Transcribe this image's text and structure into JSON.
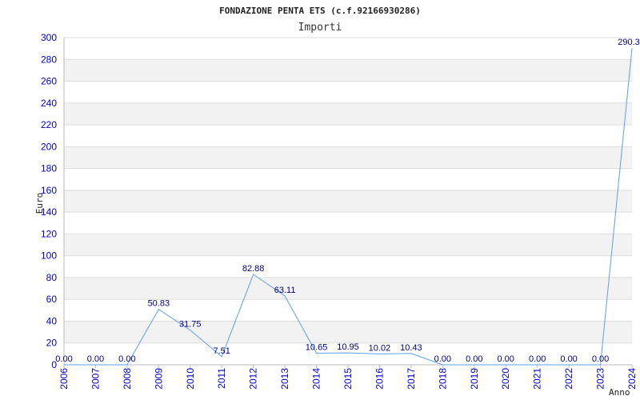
{
  "chart_data": {
    "type": "line",
    "title": "FONDAZIONE PENTA ETS (c.f.92166930286)",
    "subtitle": "Importi",
    "xlabel": "Anno",
    "ylabel": "Euro",
    "categories": [
      "2006",
      "2007",
      "2008",
      "2009",
      "2010",
      "2011",
      "2012",
      "2013",
      "2014",
      "2015",
      "2016",
      "2017",
      "2018",
      "2019",
      "2020",
      "2021",
      "2022",
      "2023",
      "2024"
    ],
    "values": [
      0.0,
      0.0,
      0.0,
      50.83,
      31.75,
      7.51,
      82.88,
      63.11,
      10.65,
      10.95,
      10.02,
      10.43,
      0.0,
      0.0,
      0.0,
      0.0,
      0.0,
      0.0,
      290.3
    ],
    "data_labels": [
      "0.00",
      "0.00",
      "0.00",
      "50.83",
      "31.75",
      "7.51",
      "82.88",
      "63.11",
      "10.65",
      "10.95",
      "10.02",
      "10.43",
      "0.00",
      "0.00",
      "0.00",
      "0.00",
      "0.00",
      "0.00",
      "290.3"
    ],
    "ylim": [
      0,
      300
    ],
    "yticks": [
      "0",
      "20",
      "40",
      "60",
      "80",
      "100",
      "120",
      "140",
      "160",
      "180",
      "200",
      "220",
      "240",
      "260",
      "280",
      "300"
    ],
    "grid": true,
    "colors": {
      "line": "#5aa0e8",
      "tick_text": "#0000cc",
      "label_text": "#000080",
      "band": "#f2f2f2",
      "grid": "#dddddd"
    }
  }
}
